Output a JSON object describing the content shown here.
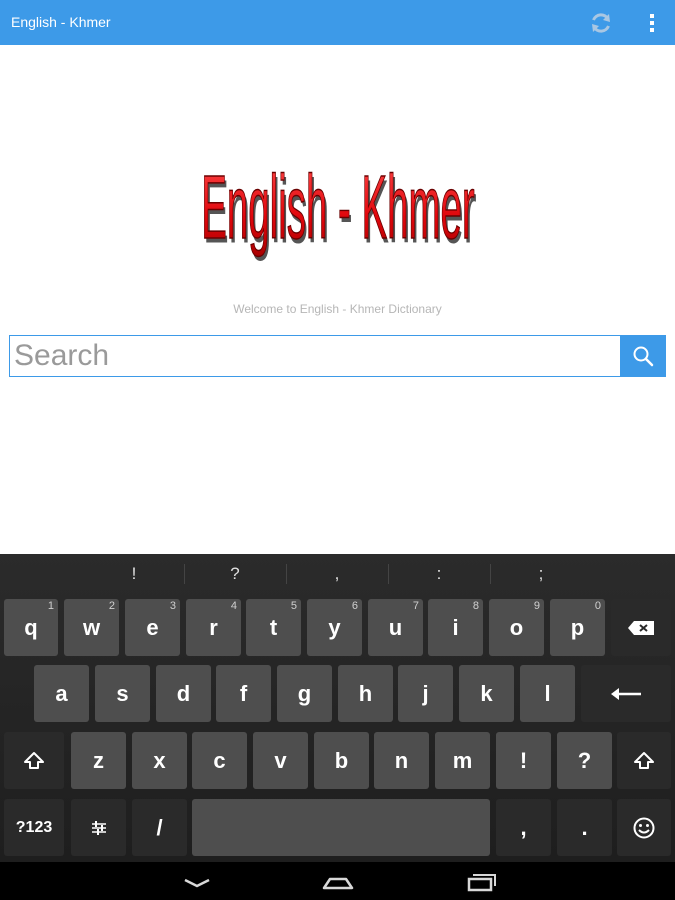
{
  "appbar": {
    "title": "English - Khmer",
    "refresh_icon": "refresh-icon",
    "overflow_icon": "more-vertical-icon",
    "color": "#3d9ae8"
  },
  "logo": {
    "text": "English - Khmer",
    "color": "#e8141a"
  },
  "welcome": "Welcome to English - Khmer Dictionary",
  "search": {
    "placeholder": "Search",
    "value": "",
    "button_icon": "search-icon"
  },
  "keyboard": {
    "suggestions": [
      "!",
      "?",
      ",",
      ":",
      ";"
    ],
    "row1": [
      {
        "label": "q",
        "hint": "1"
      },
      {
        "label": "w",
        "hint": "2"
      },
      {
        "label": "e",
        "hint": "3"
      },
      {
        "label": "r",
        "hint": "4"
      },
      {
        "label": "t",
        "hint": "5"
      },
      {
        "label": "y",
        "hint": "6"
      },
      {
        "label": "u",
        "hint": "7"
      },
      {
        "label": "i",
        "hint": "8"
      },
      {
        "label": "o",
        "hint": "9"
      },
      {
        "label": "p",
        "hint": "0"
      }
    ],
    "row2": [
      "a",
      "s",
      "d",
      "f",
      "g",
      "h",
      "j",
      "k",
      "l"
    ],
    "row3": [
      "z",
      "x",
      "c",
      "v",
      "b",
      "n",
      "m",
      "!",
      "?"
    ],
    "symbols_label": "?123",
    "slash_label": "/",
    "comma_label": ",",
    "period_label": ".",
    "icons": {
      "backspace": "backspace-icon",
      "enter": "enter-icon",
      "shift": "shift-icon",
      "settings": "keyboard-settings-icon",
      "emoji": "emoji-icon"
    }
  },
  "navbar": {
    "back": "back-icon",
    "home": "home-icon",
    "recents": "recents-icon"
  }
}
